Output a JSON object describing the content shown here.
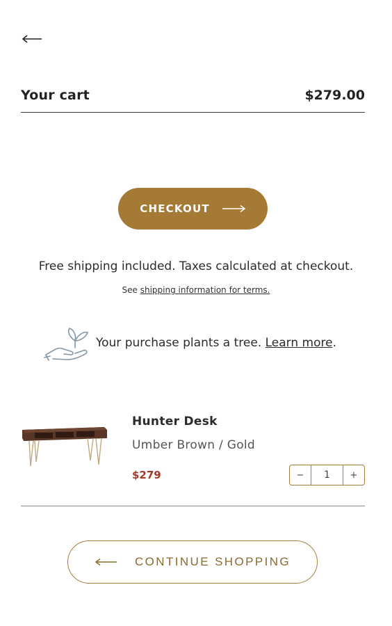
{
  "nav": {
    "back_icon": "arrow-left-icon"
  },
  "cart": {
    "title": "Your cart",
    "total": "$279.00"
  },
  "checkout": {
    "label": "CHECKOUT",
    "icon": "arrow-right-icon",
    "color": "#a57a35"
  },
  "shipping": {
    "note": "Free shipping included. Taxes calculated at checkout.",
    "prefix": "See ",
    "link_text": "shipping information for terms."
  },
  "tree": {
    "icon": "plant-hand-icon",
    "text": "Your purchase plants a tree. ",
    "link_text": "Learn more",
    "suffix": "."
  },
  "items": [
    {
      "name": "Hunter Desk",
      "variant": "Umber Brown / Gold",
      "price": "$279",
      "quantity": "1",
      "decrement": "−",
      "increment": "+"
    }
  ],
  "continue": {
    "label": "CONTINUE SHOPPING",
    "icon": "arrow-left-icon"
  },
  "colors": {
    "accent": "#a57a35",
    "price": "#a13a27"
  }
}
